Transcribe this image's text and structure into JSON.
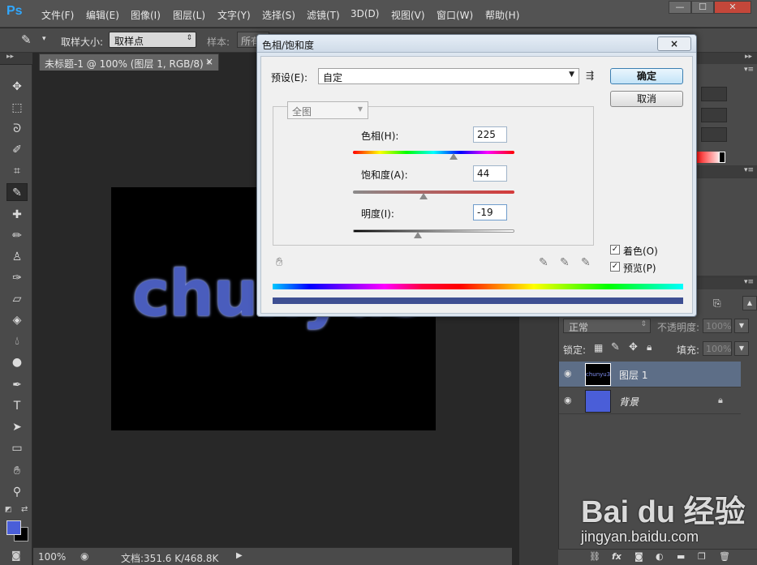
{
  "app": {
    "logo": "Ps",
    "menu": [
      "文件(F)",
      "编辑(E)",
      "图像(I)",
      "图层(L)",
      "文字(Y)",
      "选择(S)",
      "滤镜(T)",
      "3D(D)",
      "视图(V)",
      "窗口(W)",
      "帮助(H)"
    ],
    "window_buttons": [
      "—",
      "☐",
      "✕"
    ]
  },
  "options_bar": {
    "sample_size_label": "取样大小:",
    "sample_size_value": "取样点",
    "sample_label": "样本:",
    "sample_value": "所有"
  },
  "document": {
    "tab_title": "未标题-1 @ 100% (图层 1, RGB/8) *",
    "tab_close": "×",
    "canvas_text": "chunyu3"
  },
  "status": {
    "zoom": "100%",
    "doc_info": "文档:351.6 K/468.8K"
  },
  "layers_panel": {
    "blend_mode": "正常",
    "opacity_label": "不透明度:",
    "opacity_value": "100%",
    "lock_label": "锁定:",
    "fill_label": "填充:",
    "fill_value": "100%",
    "layers": [
      {
        "name": "图层 1",
        "thumb_text": "chunyu3",
        "selected": true
      },
      {
        "name": "背景",
        "selected": false,
        "locked": true
      }
    ],
    "footer_icons": [
      "link-icon",
      "fx-icon",
      "mask-icon",
      "adjustment-icon",
      "group-icon",
      "new-layer-icon",
      "trash-icon"
    ]
  },
  "dialog": {
    "title": "色相/饱和度",
    "close_label": "×",
    "preset_label": "预设(E):",
    "preset_value": "自定",
    "ok_label": "确定",
    "cancel_label": "取消",
    "channel_value": "全图",
    "hue_label": "色相(H):",
    "hue_value": "225",
    "saturation_label": "饱和度(A):",
    "saturation_value": "44",
    "lightness_label": "明度(I):",
    "lightness_value": "-19",
    "colorize_label": "着色(O)",
    "colorize_checked": true,
    "preview_label": "预览(P)",
    "preview_checked": true
  },
  "colors": {
    "foreground": "#4a5ed8",
    "background": "#000000",
    "selected_layer": "#5d6e87"
  },
  "watermark": {
    "logo": "Bai du 经验",
    "url": "jingyan.baidu.com"
  }
}
